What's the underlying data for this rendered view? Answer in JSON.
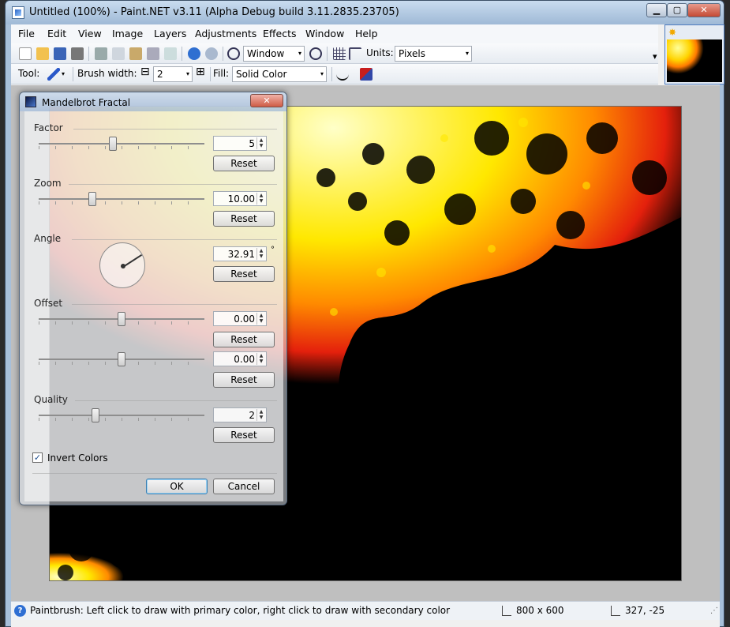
{
  "window": {
    "title": "Untitled (100%) - Paint.NET v3.11 (Alpha Debug build 3.11.2835.23705)",
    "min_glyph": "▁",
    "max_glyph": "▢",
    "close_glyph": "✕"
  },
  "menu": [
    "File",
    "Edit",
    "View",
    "Image",
    "Layers",
    "Adjustments",
    "Effects",
    "Window",
    "Help"
  ],
  "toolbar": {
    "zoom_value": "Window",
    "units_label": "Units:",
    "units_value": "Pixels",
    "tool_label": "Tool:",
    "brush_width_label": "Brush width:",
    "brush_width_value": "2",
    "minus_glyph": "⊟",
    "plus_glyph": "⊞",
    "fill_label": "Fill:",
    "fill_value": "Solid Color",
    "dropdown_glyph": "▾"
  },
  "status": {
    "help_glyph": "?",
    "text": "Paintbrush: Left click to draw with primary color, right click to draw with secondary color",
    "image_size": "800 x 600",
    "cursor_pos": "327, -25"
  },
  "dialog": {
    "title": "Mandelbrot Fractal",
    "close_glyph": "✕",
    "spin_up": "▲",
    "spin_down": "▼",
    "factor": {
      "label": "Factor",
      "value": "5",
      "reset": "Reset"
    },
    "zoom": {
      "label": "Zoom",
      "value": "10.00",
      "reset": "Reset"
    },
    "angle": {
      "label": "Angle",
      "value": "32.91",
      "unit": "°",
      "reset": "Reset"
    },
    "offset": {
      "label": "Offset",
      "x_value": "0.00",
      "y_value": "0.00",
      "reset_x": "Reset",
      "reset_y": "Reset"
    },
    "quality": {
      "label": "Quality",
      "value": "2",
      "reset": "Reset"
    },
    "invert": {
      "label": "Invert Colors",
      "checked": true,
      "check_glyph": "✓"
    },
    "ok": "OK",
    "cancel": "Cancel"
  },
  "colors": {
    "fractal_black": "#000000",
    "fractal_red": "#e4200c",
    "fractal_orange": "#ff8a00",
    "fractal_yellow": "#ffe800",
    "fractal_pale": "#ffffc8"
  }
}
